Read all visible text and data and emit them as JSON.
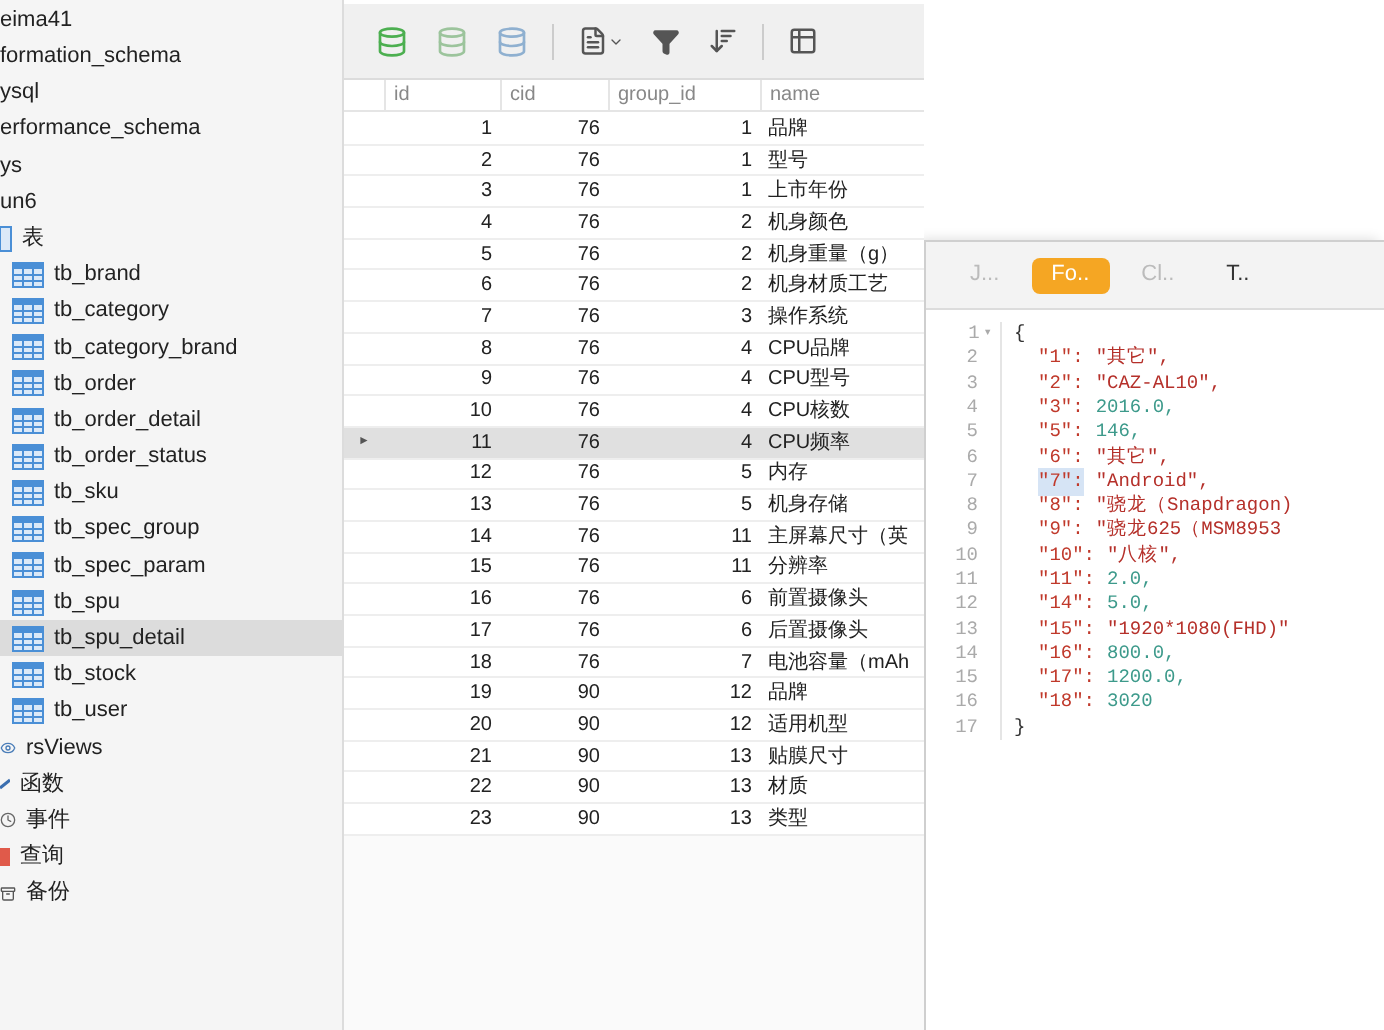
{
  "sidebar": {
    "items": [
      {
        "label": "eima41",
        "kind": "cut",
        "selected": false
      },
      {
        "label": "formation_schema",
        "kind": "cut",
        "selected": false
      },
      {
        "label": "ysql",
        "kind": "cut",
        "selected": false
      },
      {
        "label": "erformance_schema",
        "kind": "cut",
        "selected": false
      },
      {
        "label": "ys",
        "kind": "cut",
        "selected": false
      },
      {
        "label": "un6",
        "kind": "cut",
        "selected": false
      },
      {
        "label": "表",
        "kind": "group",
        "selected": false
      },
      {
        "label": "tb_brand",
        "kind": "table",
        "selected": false
      },
      {
        "label": "tb_category",
        "kind": "table",
        "selected": false
      },
      {
        "label": "tb_category_brand",
        "kind": "table",
        "selected": false
      },
      {
        "label": "tb_order",
        "kind": "table",
        "selected": false
      },
      {
        "label": "tb_order_detail",
        "kind": "table",
        "selected": false
      },
      {
        "label": "tb_order_status",
        "kind": "table",
        "selected": false
      },
      {
        "label": "tb_sku",
        "kind": "table",
        "selected": false
      },
      {
        "label": "tb_spec_group",
        "kind": "table",
        "selected": false
      },
      {
        "label": "tb_spec_param",
        "kind": "table",
        "selected": false
      },
      {
        "label": "tb_spu",
        "kind": "table",
        "selected": false
      },
      {
        "label": "tb_spu_detail",
        "kind": "table",
        "selected": true
      },
      {
        "label": "tb_stock",
        "kind": "table",
        "selected": false
      },
      {
        "label": "tb_user",
        "kind": "table",
        "selected": false
      },
      {
        "label": "rsViews",
        "kind": "views",
        "selected": false
      },
      {
        "label": "函数",
        "kind": "functions",
        "selected": false
      },
      {
        "label": "事件",
        "kind": "events",
        "selected": false
      },
      {
        "label": "查询",
        "kind": "queries",
        "selected": false
      },
      {
        "label": "备份",
        "kind": "backups",
        "selected": false
      }
    ]
  },
  "table": {
    "columns": [
      "id",
      "cid",
      "group_id",
      "name"
    ],
    "rows": [
      {
        "cells": [
          "1",
          "76",
          "1",
          "品牌"
        ],
        "selected": false
      },
      {
        "cells": [
          "2",
          "76",
          "1",
          "型号"
        ],
        "selected": false
      },
      {
        "cells": [
          "3",
          "76",
          "1",
          "上市年份"
        ],
        "selected": false
      },
      {
        "cells": [
          "4",
          "76",
          "2",
          "机身颜色"
        ],
        "selected": false
      },
      {
        "cells": [
          "5",
          "76",
          "2",
          "机身重量（g）"
        ],
        "selected": false
      },
      {
        "cells": [
          "6",
          "76",
          "2",
          "机身材质工艺"
        ],
        "selected": false
      },
      {
        "cells": [
          "7",
          "76",
          "3",
          "操作系统"
        ],
        "selected": false
      },
      {
        "cells": [
          "8",
          "76",
          "4",
          "CPU品牌"
        ],
        "selected": false
      },
      {
        "cells": [
          "9",
          "76",
          "4",
          "CPU型号"
        ],
        "selected": false
      },
      {
        "cells": [
          "10",
          "76",
          "4",
          "CPU核数"
        ],
        "selected": false
      },
      {
        "cells": [
          "11",
          "76",
          "4",
          "CPU频率"
        ],
        "selected": true,
        "marker": "►"
      },
      {
        "cells": [
          "12",
          "76",
          "5",
          "内存"
        ],
        "selected": false
      },
      {
        "cells": [
          "13",
          "76",
          "5",
          "机身存储"
        ],
        "selected": false
      },
      {
        "cells": [
          "14",
          "76",
          "11",
          "主屏幕尺寸（英"
        ],
        "selected": false
      },
      {
        "cells": [
          "15",
          "76",
          "11",
          "分辨率"
        ],
        "selected": false
      },
      {
        "cells": [
          "16",
          "76",
          "6",
          "前置摄像头"
        ],
        "selected": false
      },
      {
        "cells": [
          "17",
          "76",
          "6",
          "后置摄像头"
        ],
        "selected": false
      },
      {
        "cells": [
          "18",
          "76",
          "7",
          "电池容量（mAh"
        ],
        "selected": false
      },
      {
        "cells": [
          "19",
          "90",
          "12",
          "品牌"
        ],
        "selected": false
      },
      {
        "cells": [
          "20",
          "90",
          "12",
          "适用机型"
        ],
        "selected": false
      },
      {
        "cells": [
          "21",
          "90",
          "13",
          "贴膜尺寸"
        ],
        "selected": false
      },
      {
        "cells": [
          "22",
          "90",
          "13",
          "材质"
        ],
        "selected": false
      },
      {
        "cells": [
          "23",
          "90",
          "13",
          "类型"
        ],
        "selected": false
      }
    ]
  },
  "viewer": {
    "tabs": [
      {
        "label": "J...",
        "selected": false
      },
      {
        "label": "Fo..",
        "selected": true
      },
      {
        "label": "Cl..",
        "selected": false
      },
      {
        "label": "T..",
        "selected": false
      }
    ],
    "lines": [
      {
        "number": "1",
        "kind": "brace",
        "text": "{",
        "fold": "▾"
      },
      {
        "number": "2",
        "kind": "string",
        "key": "\"1\":",
        "value": "\"其它\",",
        "highlighted": false
      },
      {
        "number": "3",
        "kind": "string",
        "key": "\"2\":",
        "value": "\"CAZ-AL10\",",
        "highlighted": false
      },
      {
        "number": "4",
        "kind": "number",
        "key": "\"3\":",
        "value": "2016.0,",
        "highlighted": false
      },
      {
        "number": "5",
        "kind": "number",
        "key": "\"5\":",
        "value": "146,",
        "highlighted": false
      },
      {
        "number": "6",
        "kind": "string",
        "key": "\"6\":",
        "value": "\"其它\",",
        "highlighted": false
      },
      {
        "number": "7",
        "kind": "string",
        "key": "\"7\":",
        "value": "\"Android\",",
        "highlighted": true
      },
      {
        "number": "8",
        "kind": "string",
        "key": "\"8\":",
        "value": "\"骁龙（Snapdragon)",
        "highlighted": false
      },
      {
        "number": "9",
        "kind": "string",
        "key": "\"9\":",
        "value": "\"骁龙625（MSM8953",
        "highlighted": false
      },
      {
        "number": "10",
        "kind": "string",
        "key": "\"10\":",
        "value": "\"八核\",",
        "highlighted": false
      },
      {
        "number": "11",
        "kind": "number",
        "key": "\"11\":",
        "value": "2.0,",
        "highlighted": false
      },
      {
        "number": "12",
        "kind": "number",
        "key": "\"14\":",
        "value": "5.0,",
        "highlighted": false
      },
      {
        "number": "13",
        "kind": "string",
        "key": "\"15\":",
        "value": "\"1920*1080(FHD)\"",
        "highlighted": false
      },
      {
        "number": "14",
        "kind": "number",
        "key": "\"16\":",
        "value": "800.0,",
        "highlighted": false
      },
      {
        "number": "15",
        "kind": "number",
        "key": "\"17\":",
        "value": "1200.0,",
        "highlighted": false
      },
      {
        "number": "16",
        "kind": "number",
        "key": "\"18\":",
        "value": "3020",
        "highlighted": false
      },
      {
        "number": "17",
        "kind": "brace",
        "text": "}"
      }
    ]
  }
}
